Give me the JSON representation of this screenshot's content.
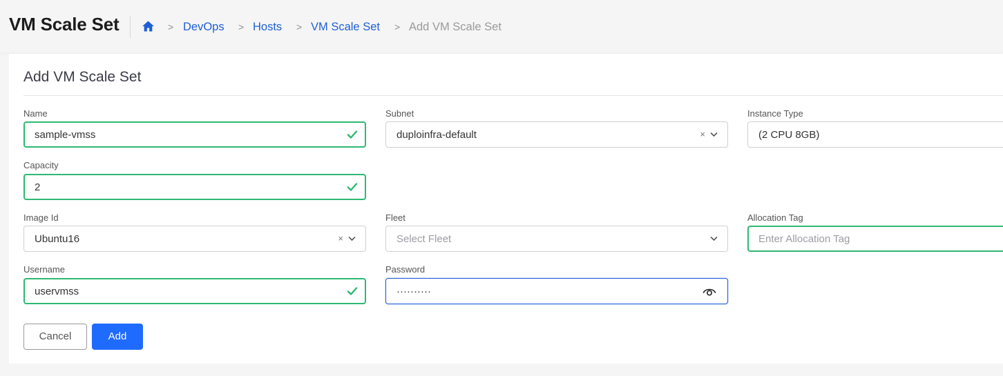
{
  "header": {
    "title": "VM Scale Set",
    "breadcrumb": [
      "DevOps",
      "Hosts",
      "VM Scale Set",
      "Add VM Scale Set"
    ],
    "separator": ">"
  },
  "form": {
    "title": "Add VM Scale Set",
    "name": {
      "label": "Name",
      "value": "sample-vmss"
    },
    "subnet": {
      "label": "Subnet",
      "value": "duploinfra-default"
    },
    "instance_type": {
      "label": "Instance Type",
      "value": "(2 CPU 8GB)"
    },
    "capacity": {
      "label": "Capacity",
      "value": "2"
    },
    "image_id": {
      "label": "Image Id",
      "value": "Ubuntu16"
    },
    "fleet": {
      "label": "Fleet",
      "placeholder": "Select Fleet"
    },
    "allocation_tag": {
      "label": "Allocation Tag",
      "placeholder": "Enter Allocation Tag"
    },
    "username": {
      "label": "Username",
      "value": "uservmss"
    },
    "password": {
      "label": "Password",
      "value": "··········"
    },
    "clear_glyph": "×"
  },
  "actions": {
    "cancel": "Cancel",
    "add": "Add"
  },
  "colors": {
    "primary": "#1f6bff",
    "link": "#1d5fd7",
    "valid": "#2eb872"
  }
}
